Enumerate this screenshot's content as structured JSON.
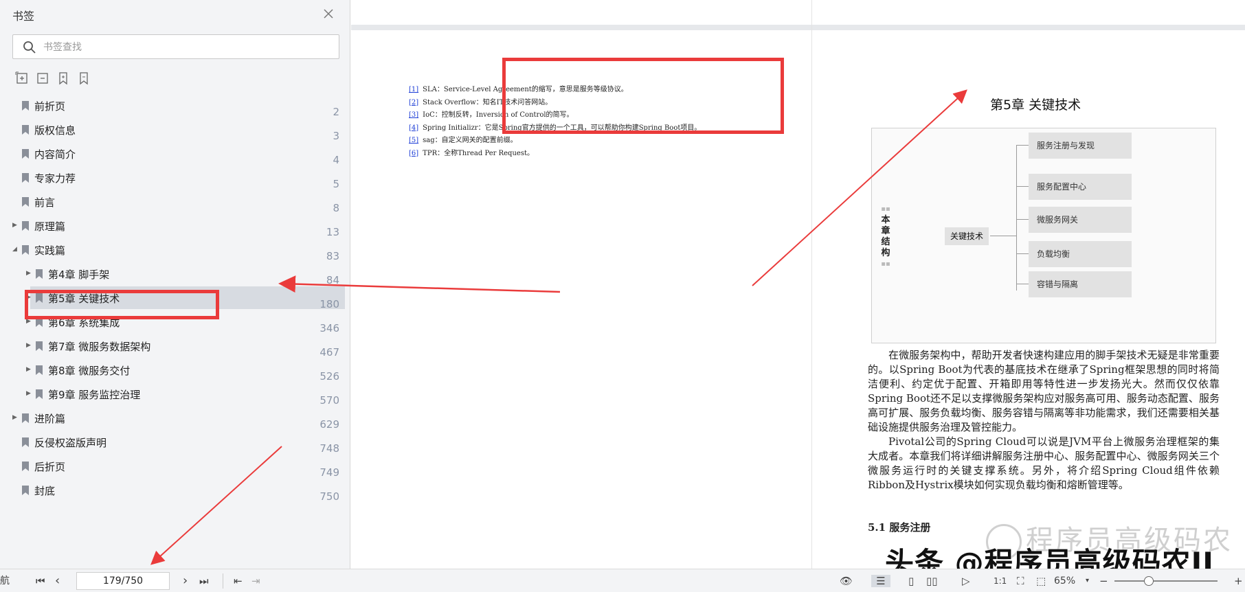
{
  "sidebar": {
    "title": "书签",
    "search_placeholder": "书签查找",
    "bookmarks": [
      {
        "label": "前折页",
        "page": "2"
      },
      {
        "label": "版权信息",
        "page": "3"
      },
      {
        "label": "内容简介",
        "page": "4"
      },
      {
        "label": "专家力荐",
        "page": "5"
      },
      {
        "label": "前言",
        "page": "8"
      },
      {
        "label": "原理篇",
        "page": "13"
      },
      {
        "label": "实践篇",
        "page": "83"
      },
      {
        "label": "第4章 脚手架",
        "page": "84"
      },
      {
        "label": "第5章 关键技术",
        "page": "180"
      },
      {
        "label": "第6章 系统集成",
        "page": "346"
      },
      {
        "label": "第7章 微服务数据架构",
        "page": "467"
      },
      {
        "label": "第8章 微服务交付",
        "page": "526"
      },
      {
        "label": "第9章 服务监控治理",
        "page": "570"
      },
      {
        "label": "进阶篇",
        "page": "629"
      },
      {
        "label": "反侵权盗版声明",
        "page": "748"
      },
      {
        "label": "后折页",
        "page": "749"
      },
      {
        "label": "封底",
        "page": "750"
      }
    ]
  },
  "footnotes": [
    {
      "ref": "[1]",
      "text": "SLA：Service-Level Agreement的缩写，意思是服务等级协议。"
    },
    {
      "ref": "[2]",
      "text": "Stack Overflow：知名IT技术问答网站。"
    },
    {
      "ref": "[3]",
      "text": "IoC：控制反转，Inversion of Control的简写。"
    },
    {
      "ref": "[4]",
      "text": "Spring Initializr：它是Spring官方提供的一个工具，可以帮助你构建Spring Boot项目。"
    },
    {
      "ref": "[5]",
      "text": "sag：自定义网关的配置前缀。"
    },
    {
      "ref": "[6]",
      "text": "TPR：全称Thread Per Request。"
    }
  ],
  "page": {
    "chapter_title": "第5章  关键技术",
    "diagram": {
      "side_label": "本章结构",
      "center": "关键技术",
      "nodes": [
        "服务注册与发现",
        "服务配置中心",
        "微服务网关",
        "负载均衡",
        "容错与隔离"
      ]
    },
    "paragraphs": [
      "在微服务架构中，帮助开发者快速构建应用的脚手架技术无疑是非常重要的。以Spring Boot为代表的基底技术在继承了Spring框架思想的同时将简洁便利、约定优于配置、开箱即用等特性进一步发扬光大。然而仅仅依靠Spring Boot还不足以支撑微服务架构应对服务高可用、服务动态配置、服务高可扩展、服务负载均衡、服务容错与隔离等非功能需求，我们还需要相关基础设施提供服务治理及管控能力。",
      "Pivotal公司的Spring Cloud可以说是JVM平台上微服务治理框架的集大成者。本章我们将详细讲解服务注册中心、服务配置中心、微服务网关三个微服务运行时的关键支撑系统。另外，将介绍Spring Cloud组件依赖Ribbon及Hystrix模块如何实现负载均衡和熔断管理等。"
    ],
    "section_heading": "5.1 服务注册",
    "watermark_light": "程序员高级码农",
    "watermark_dark": "头条 @程序员高级码农II"
  },
  "statusbar": {
    "nav_label": "航",
    "page_value": "179/750",
    "zoom": "65%"
  }
}
